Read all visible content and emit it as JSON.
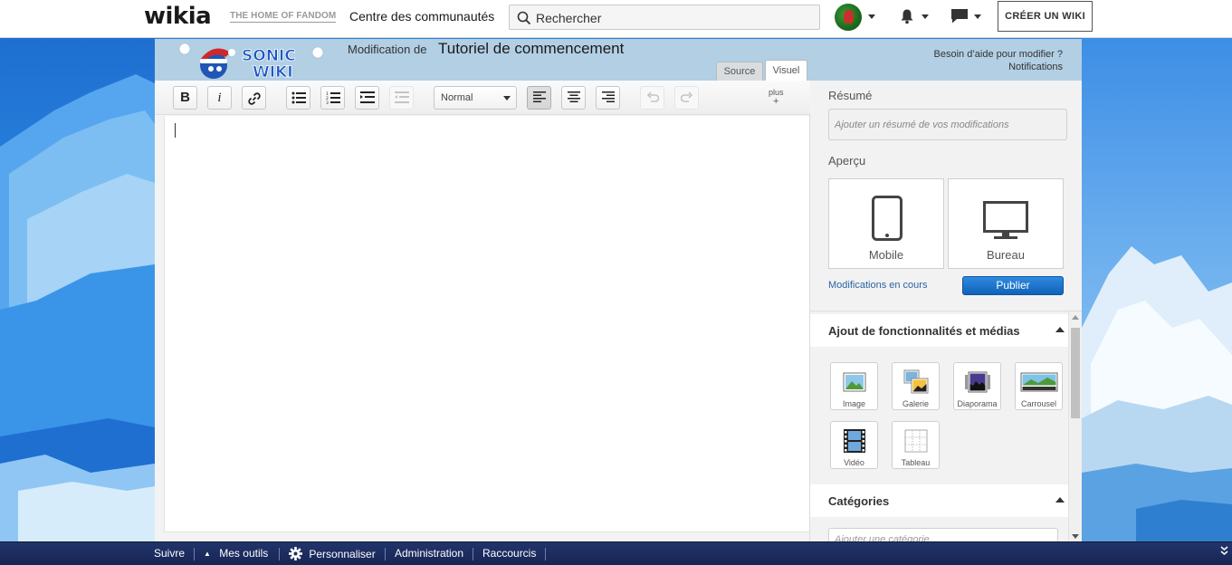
{
  "topnav": {
    "logo": "wikia",
    "tagline": "THE HOME OF FANDOM",
    "communities": "Centre des communautés",
    "search_placeholder": "Rechercher",
    "create_wiki": "CRÉER UN WIKI"
  },
  "editor": {
    "wiki_logo_text": "SONIC WIKI",
    "edit_prefix": "Modification de",
    "page_title": "Tutoriel de commencement",
    "tabs": [
      "Source",
      "Visuel"
    ],
    "help": "Besoin d’aide pour modifier ?",
    "notifications": "Notifications"
  },
  "toolbar": {
    "format": "Normal",
    "more": "plus",
    "more_symbol": "+"
  },
  "rail": {
    "summary_label": "Résumé",
    "summary_placeholder": "Ajouter un résumé de vos modifications",
    "preview_label": "Aperçu",
    "preview_mobile": "Mobile",
    "preview_desktop": "Bureau",
    "in_progress": "Modifications en cours",
    "publish": "Publier",
    "features_title": "Ajout de fonctionnalités et médias",
    "media": [
      "Image",
      "Galerie",
      "Diaporama",
      "Carrousel",
      "Vidéo",
      "Tableau"
    ],
    "categories_title": "Catégories",
    "category_placeholder": "Ajouter une catégorie"
  },
  "bottombar": {
    "follow": "Suivre",
    "my_tools": "Mes outils",
    "customize": "Personnaliser",
    "admin": "Administration",
    "shortcuts": "Raccourcis"
  },
  "colors": {
    "header_bg": "#b2cfe4",
    "publish": "#1a73c9",
    "bottombar": "#1c2c5e",
    "link": "#2c64a3"
  }
}
